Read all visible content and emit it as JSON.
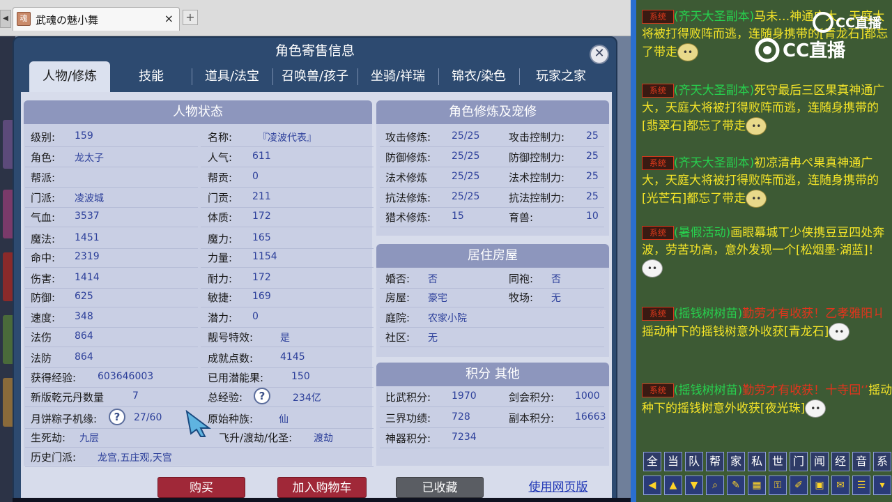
{
  "browser": {
    "tab_title": "武魂の魅小舞",
    "tab_close": "×",
    "new_tab": "+",
    "scroll_arrow": "◀"
  },
  "dialog": {
    "title": "角色寄售信息",
    "close_glyph": "✕",
    "tabs": [
      "人物/修炼",
      "技能",
      "道具/法宝",
      "召唤兽/孩子",
      "坐骑/祥瑞",
      "锦衣/染色",
      "玩家之家"
    ]
  },
  "status": {
    "header": "人物状态",
    "left": [
      {
        "label": "级别:",
        "value": "159"
      },
      {
        "label": "角色:",
        "value": "龙太子"
      },
      {
        "label": "帮派:",
        "value": ""
      },
      {
        "label": "门派:",
        "value": "凌波城"
      },
      {
        "label": "气血:",
        "value": "3537"
      },
      {
        "label": "魔法:",
        "value": "1451"
      },
      {
        "label": "命中:",
        "value": "2319"
      },
      {
        "label": "伤害:",
        "value": "1414"
      },
      {
        "label": "防御:",
        "value": "625"
      },
      {
        "label": "速度:",
        "value": "348"
      },
      {
        "label": "法伤",
        "value": "864"
      },
      {
        "label": "法防",
        "value": "864"
      }
    ],
    "right": [
      {
        "label": "名称:",
        "value": "『凌波代表』"
      },
      {
        "label": "人气:",
        "value": "611"
      },
      {
        "label": "帮贡:",
        "value": "0"
      },
      {
        "label": "门贡:",
        "value": "211"
      },
      {
        "label": "体质:",
        "value": "172"
      },
      {
        "label": "魔力:",
        "value": "165"
      },
      {
        "label": "力量:",
        "value": "1154"
      },
      {
        "label": "耐力:",
        "value": "172"
      },
      {
        "label": "敏捷:",
        "value": "169"
      },
      {
        "label": "潜力:",
        "value": "0"
      },
      {
        "label": "靓号特效:",
        "value": "是"
      },
      {
        "label": "成就点数:",
        "value": "4145"
      }
    ],
    "extra": [
      {
        "label": "获得经验:",
        "value": "603646003",
        "label2": "已用潜能果:",
        "value2": "150"
      },
      {
        "label": "新版乾元丹数量",
        "value": "7",
        "label2": "总经验:",
        "value2": "234亿"
      },
      {
        "label": "月饼粽子机缘:",
        "value": "27/60",
        "label2": "原始种族:",
        "value2": "仙"
      },
      {
        "label": "生死劫:",
        "value": "九层",
        "label2": "飞升/渡劫/化圣:",
        "value2": "渡劫"
      },
      {
        "label": "历史门派:",
        "value": "龙宫,五庄观,天宫"
      }
    ],
    "help_glyph": "?"
  },
  "cultivation": {
    "header": "角色修炼及宠修",
    "rows": [
      {
        "label": "攻击修炼:",
        "value": "25/25",
        "label2": "攻击控制力:",
        "value2": "25"
      },
      {
        "label": "防御修炼:",
        "value": "25/25",
        "label2": "防御控制力:",
        "value2": "25"
      },
      {
        "label": "法术修炼",
        "value": "25/25",
        "label2": "法术控制力:",
        "value2": "25"
      },
      {
        "label": "抗法修炼:",
        "value": "25/25",
        "label2": "抗法控制力:",
        "value2": "25"
      },
      {
        "label": "猎术修炼:",
        "value": "15",
        "label2": "育兽:",
        "value2": "10"
      }
    ]
  },
  "housing": {
    "header": "居住房屋",
    "rows": [
      {
        "label": "婚否:",
        "value": "否",
        "label2": "同袍:",
        "value2": "否"
      },
      {
        "label": "房屋:",
        "value": "豪宅",
        "label2": "牧场:",
        "value2": "无"
      },
      {
        "label": "庭院:",
        "value": "农家小院",
        "label2": "",
        "value2": ""
      },
      {
        "label": "社区:",
        "value": "无",
        "label2": "",
        "value2": ""
      }
    ]
  },
  "points": {
    "header": "积分 其他",
    "rows": [
      {
        "label": "比武积分:",
        "value": "1970",
        "label2": "剑会积分:",
        "value2": "1000"
      },
      {
        "label": "三界功绩:",
        "value": "728",
        "label2": "副本积分:",
        "value2": "16663"
      },
      {
        "label": "神器积分:",
        "value": "7234",
        "label2": "",
        "value2": ""
      }
    ]
  },
  "buttons": {
    "buy": "购买",
    "cart": "加入购物车",
    "favorited": "已收藏",
    "web": "使用网页版"
  },
  "chat": {
    "logo": "CC直播",
    "sys_badge": "系统",
    "messages": [
      {
        "tag": "(齐天大圣副本)",
        "name": "马未…",
        "body": "神通广大，天庭大将被打得败阵而逃，连随身携带的[青龙石]都忘了带走"
      },
      {
        "tag": "(齐天大圣副本)",
        "name": "死守最后三区",
        "body": "果真神通广大，天庭大将被打得败阵而逃，连随身携带的[翡翠石]都忘了带走"
      },
      {
        "tag": "(齐天大圣副本)",
        "name": "初凉清冉ぺ",
        "body": "果真神通广大，天庭大将被打得败阵而逃，连随身携带的[光芒石]都忘了带走"
      },
      {
        "tag": "(暑假活动)",
        "name": "画眼幕城ㄒ",
        "body": "少侠携豆豆四处奔波，劳苦功高，意外发现一个[松烟墨·湖蓝]！"
      },
      {
        "tag": "(摇钱树树苗)",
        "name": "勤劳才有收获！乙孝雅阳ㄐ",
        "body": "摇动种下的摇钱树意外收获[青龙石]"
      },
      {
        "tag": "(摇钱树树苗)",
        "name": "勤劳才有收获！十寺回‘’",
        "body": "摇动种下的摇钱树意外收获[夜光珠]"
      }
    ],
    "channels": [
      "全",
      "当",
      "队",
      "帮",
      "家",
      "私",
      "世",
      "门",
      "闻",
      "经",
      "音",
      "系"
    ],
    "icons": [
      "arrow-left-icon",
      "arrow-up-icon",
      "arrow-down-icon",
      "search-icon",
      "note-icon",
      "grid-icon",
      "lock-icon",
      "brush-icon",
      "window-icon",
      "chat-bubble-icon",
      "list-icon",
      "dropdown-icon"
    ]
  }
}
